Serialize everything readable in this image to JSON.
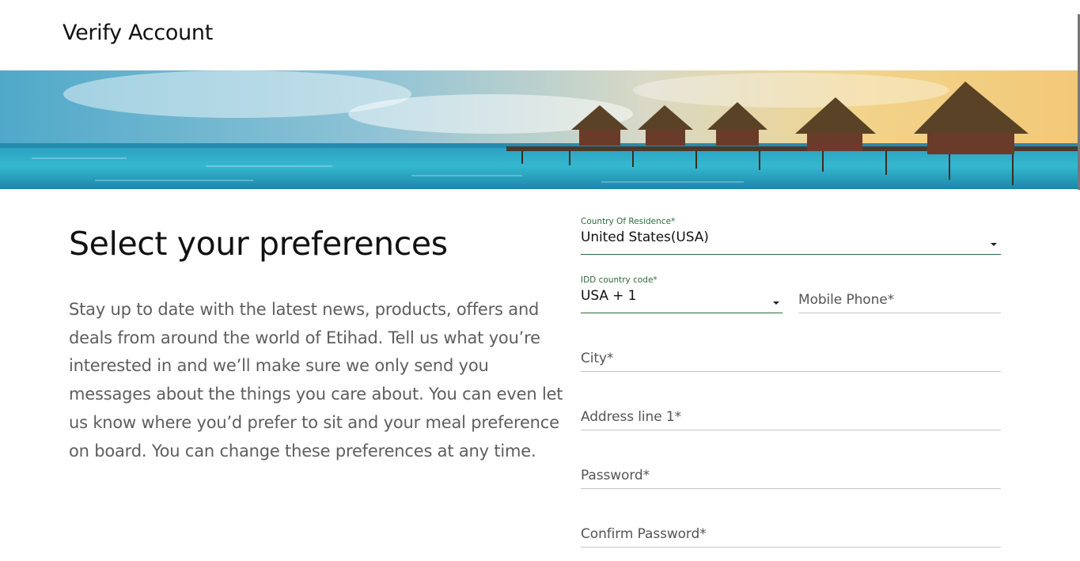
{
  "header": {
    "title": "Verify Account"
  },
  "banner": {
    "alt": "overwater-bungalows-banner"
  },
  "intro": {
    "heading": "Select your preferences",
    "description": "Stay up to date with the latest news, products, offers and deals from around the world of Etihad. Tell us what you’re interested in and we’ll make sure we only send you messages about the things you care about. You can even let us know where you’d prefer to sit and your meal preference on board. You can change these preferences at any time."
  },
  "form": {
    "country": {
      "label": "Country Of Residence*",
      "value": "United States(USA)"
    },
    "idd": {
      "label": "IDD country code*",
      "value": "USA + 1"
    },
    "mobile": {
      "placeholder": "Mobile Phone*"
    },
    "city": {
      "placeholder": "City*"
    },
    "address": {
      "placeholder": "Address line 1*"
    },
    "password": {
      "placeholder": "Password*"
    },
    "confirm_password": {
      "placeholder": "Confirm Password*"
    }
  },
  "colors": {
    "accent": "#2e6b3a",
    "heading": "#111111",
    "body_text": "#5e5e5e"
  }
}
